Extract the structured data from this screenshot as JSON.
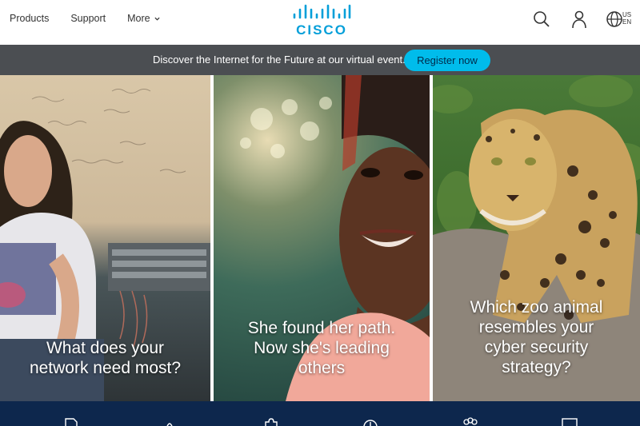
{
  "header": {
    "nav": [
      {
        "label": "Products"
      },
      {
        "label": "Support"
      },
      {
        "label": "More"
      }
    ],
    "logo_text": "CISCO",
    "locale_country": "US",
    "locale_lang": "EN"
  },
  "banner": {
    "text": "Discover the Internet for the Future at our virtual event.",
    "button_label": "Register now"
  },
  "panels": [
    {
      "caption_line1": "What does your",
      "caption_line2": "network need most?"
    },
    {
      "caption_line1": "She found her path.",
      "caption_line2": "Now she's leading",
      "caption_line3": "others"
    },
    {
      "caption_line1": "Which zoo animal",
      "caption_line2": "resembles your",
      "caption_line3": "cyber security",
      "caption_line4": "strategy?"
    }
  ],
  "colors": {
    "brand": "#049fd9",
    "banner_bg": "#4b4e52",
    "register_button": "#00bceb",
    "footer_bar": "#0d274d"
  },
  "icons": [
    "search-icon",
    "user-icon",
    "globe-icon",
    "chevron-down-icon"
  ]
}
